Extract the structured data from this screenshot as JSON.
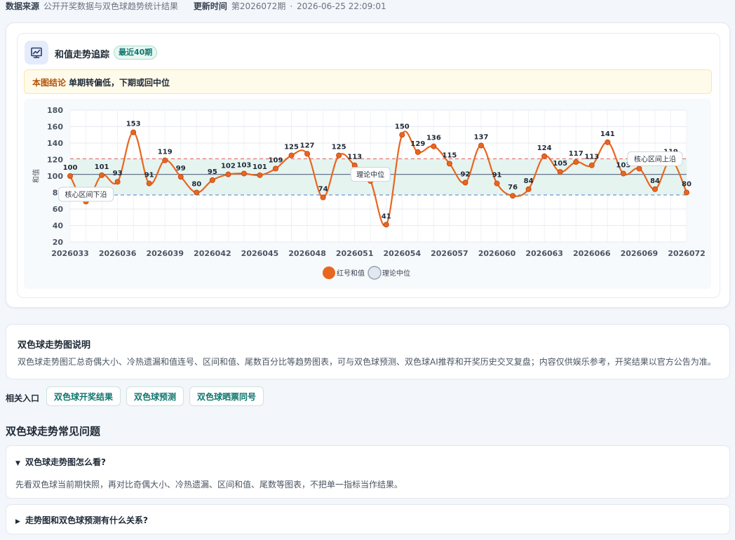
{
  "meta": {
    "source_label": "数据来源",
    "source_value": "公开开奖数据与双色球趋势统计结果",
    "update_label": "更新时间",
    "issue": "第2026072期",
    "separator": "·",
    "timestamp": "2026-06-25 22:09:01"
  },
  "trend_card": {
    "title": "和值走势追踪",
    "badge": "最近40期",
    "icon": "trend-chart-icon",
    "conclusion_label": "本图结论",
    "conclusion_text": "单期转偏低，下期或回中位"
  },
  "colors": {
    "series": "#e8661f",
    "median_line": "#64748b",
    "upper_line": "#e05d5d",
    "lower_line": "#4a7bd1",
    "band_fill": "#e3f3ee",
    "accent_green": "#0f766e"
  },
  "chart_data": {
    "type": "line",
    "title": "",
    "xlabel": "",
    "ylabel": "和值",
    "ylim": [
      20,
      180
    ],
    "yticks": [
      20,
      40,
      60,
      80,
      100,
      120,
      140,
      160,
      180
    ],
    "grid": true,
    "legend_position": "bottom-center",
    "x_tick_labels": [
      "2026033",
      "2026036",
      "2026039",
      "2026042",
      "2026045",
      "2026048",
      "2026051",
      "2026054",
      "2026057",
      "2026060",
      "2026063",
      "2026066",
      "2026069",
      "2026072"
    ],
    "x": [
      "2026033",
      "2026034",
      "2026035",
      "2026036",
      "2026037",
      "2026038",
      "2026039",
      "2026040",
      "2026041",
      "2026042",
      "2026043",
      "2026044",
      "2026045",
      "2026046",
      "2026047",
      "2026048",
      "2026049",
      "2026050",
      "2026051",
      "2026052",
      "2026053",
      "2026054",
      "2026055",
      "2026056",
      "2026057",
      "2026058",
      "2026059",
      "2026060",
      "2026061",
      "2026062",
      "2026063",
      "2026064",
      "2026065",
      "2026066",
      "2026067",
      "2026068",
      "2026069",
      "2026070",
      "2026071",
      "2026072"
    ],
    "series": [
      {
        "name": "红号和值",
        "values": [
          100,
          69,
          101,
          93,
          153,
          91,
          119,
          99,
          80,
          95,
          102,
          103,
          101,
          109,
          125,
          127,
          74,
          125,
          113,
          94,
          41,
          150,
          129,
          136,
          115,
          92,
          137,
          91,
          76,
          84,
          124,
          105,
          117,
          113,
          141,
          103,
          109,
          84,
          119,
          80
        ]
      },
      {
        "name": "理论中位",
        "values": [
          102
        ]
      }
    ],
    "band": {
      "lower": 77,
      "upper": 121
    },
    "annotations": [
      {
        "text": "核心区间下沿",
        "x": "2026034"
      },
      {
        "text": "理论中位",
        "x": "2026052"
      },
      {
        "text": "核心区间上沿",
        "x": "2026070"
      }
    ]
  },
  "description": {
    "title": "双色球走势图说明",
    "text": "双色球走势图汇总奇偶大小、冷热遗漏和值连号、区间和值、尾数百分比等趋势图表，可与双色球预测、双色球AI推荐和开奖历史交叉复盘；内容仅供娱乐参考，开奖结果以官方公告为准。"
  },
  "related": {
    "label": "相关入口",
    "links": [
      "双色球开奖结果",
      "双色球预测",
      "双色球晒票同号"
    ]
  },
  "faq": {
    "title": "双色球走势常见问题",
    "items": [
      {
        "question": "双色球走势图怎么看?",
        "answer": "先看双色球当前期快照，再对比奇偶大小、冷热遗漏、区间和值、尾数等图表，不把单一指标当作结果。",
        "expanded_marker": "▼"
      },
      {
        "question": "走势图和双色球预测有什么关系?",
        "expanded_marker": "▶"
      }
    ]
  }
}
